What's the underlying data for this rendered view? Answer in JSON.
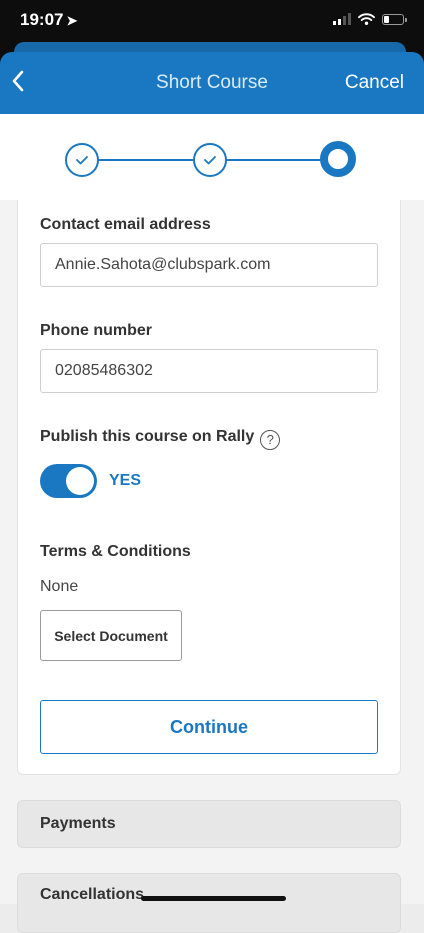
{
  "status_bar": {
    "time": "19:07",
    "location_glyph": "➤"
  },
  "nav": {
    "title": "Short Course",
    "cancel_label": "Cancel",
    "back_icon": "chevron-left-icon"
  },
  "stepper": {
    "steps": [
      "completed",
      "completed",
      "current"
    ]
  },
  "form": {
    "contact_email_label": "Contact email address",
    "contact_email_value": "Annie.Sahota@clubspark.com",
    "phone_label": "Phone number",
    "phone_value": "02085486302",
    "publish_label": "Publish this course on Rally",
    "publish_help_icon": "?",
    "publish_toggle_state": "YES",
    "terms_label": "Terms & Conditions",
    "terms_value": "None",
    "select_document_label": "Select Document",
    "continue_label": "Continue"
  },
  "sections": {
    "payments": "Payments",
    "cancellations": "Cancellations"
  },
  "colors": {
    "accent": "#1a78c2",
    "background": "#f3f3f3",
    "status_bar": "#0d0d0d"
  }
}
